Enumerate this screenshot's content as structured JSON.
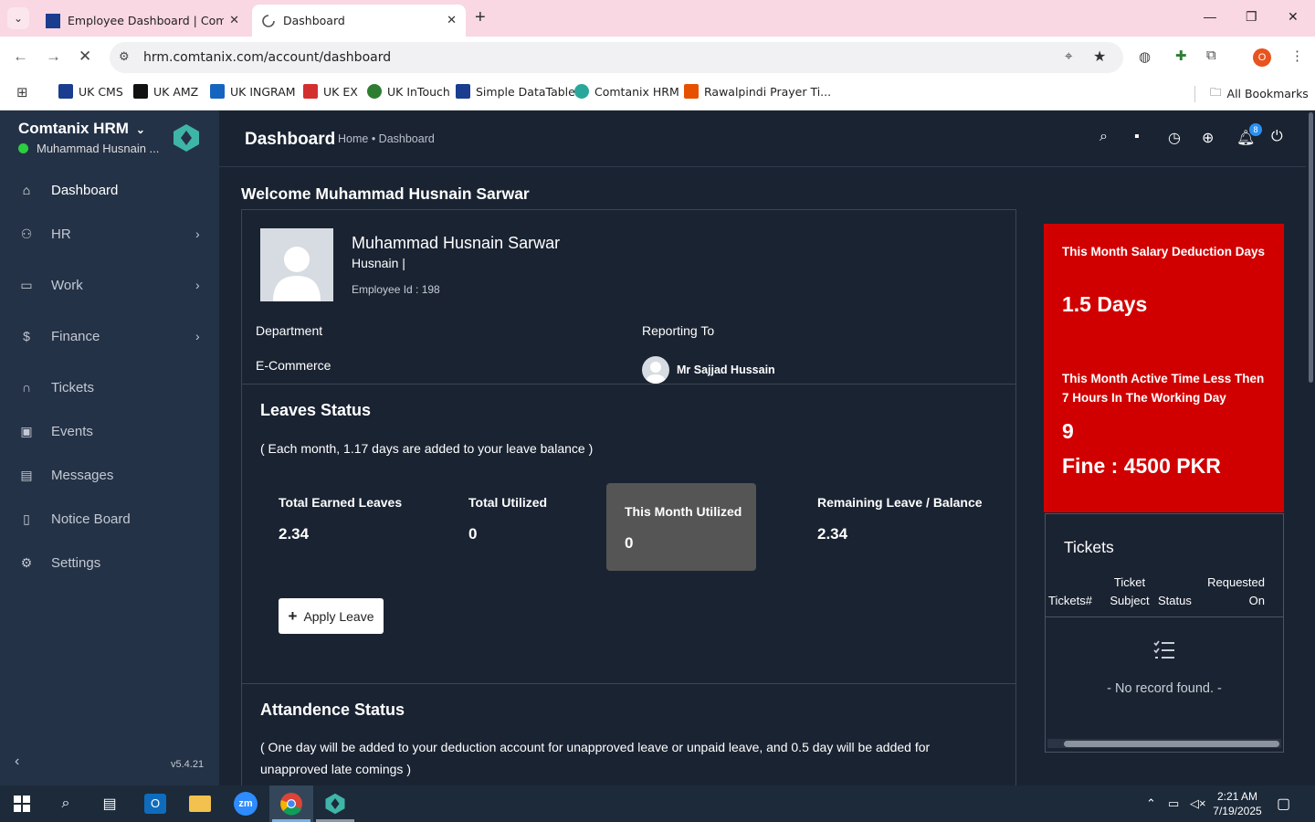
{
  "browser": {
    "tabs": [
      {
        "title": "Employee Dashboard | Comtanix",
        "active": false
      },
      {
        "title": "Dashboard",
        "active": true
      }
    ],
    "url": "hrm.comtanix.com/account/dashboard",
    "profile_initial": "O",
    "bookmarks": [
      {
        "label": "UK CMS",
        "color": "#1a3d8f"
      },
      {
        "label": "UK AMZ",
        "color": "#111111"
      },
      {
        "label": "UK INGRAM",
        "color": "#1565c0"
      },
      {
        "label": "UK EX",
        "color": "#d32f2f"
      },
      {
        "label": "UK InTouch",
        "color": "#2e7d32"
      },
      {
        "label": "Simple DataTable",
        "color": "#1a3d8f"
      },
      {
        "label": "Comtanix HRM",
        "color": "#2aa79b"
      },
      {
        "label": "Rawalpindi Prayer Ti...",
        "color": "#e65100"
      }
    ],
    "all_bookmarks": "All Bookmarks"
  },
  "sidebar": {
    "brand": "Comtanix HRM",
    "user": "Muhammad Husnain ...",
    "items": [
      {
        "label": "Dashboard",
        "icon": "home-icon",
        "active": true
      },
      {
        "label": "HR",
        "icon": "users-icon",
        "arrow": true
      },
      {
        "label": "Work",
        "icon": "briefcase-icon",
        "arrow": true
      },
      {
        "label": "Finance",
        "icon": "dollar-icon",
        "arrow": true
      },
      {
        "label": "Tickets",
        "icon": "headset-icon"
      },
      {
        "label": "Events",
        "icon": "calendar-icon"
      },
      {
        "label": "Messages",
        "icon": "message-icon"
      },
      {
        "label": "Notice Board",
        "icon": "clipboard-icon"
      },
      {
        "label": "Settings",
        "icon": "gear-icon"
      }
    ],
    "version": "v5.4.21"
  },
  "header": {
    "title": "Dashboard",
    "breadcrumb": "Home • Dashboard",
    "notification_count": "8"
  },
  "welcome": "Welcome Muhammad Husnain Sarwar",
  "profile": {
    "name": "Muhammad Husnain Sarwar",
    "nickname": "Husnain |",
    "employee_id": "Employee Id : 198",
    "department_label": "Department",
    "department": "E-Commerce",
    "reporting_label": "Reporting To",
    "reporting_to": "Mr Sajjad Hussain"
  },
  "leaves": {
    "title": "Leaves Status",
    "note": "( Each month, 1.17 days are added to your leave balance )",
    "stats": [
      {
        "label": "Total Earned Leaves",
        "value": "2.34"
      },
      {
        "label": "Total Utilized",
        "value": "0"
      },
      {
        "label": "This Month Utilized",
        "value": "0"
      },
      {
        "label": "Remaining Leave / Balance",
        "value": "2.34"
      }
    ],
    "apply_button": "Apply Leave"
  },
  "attendance": {
    "title": "Attandence Status",
    "note": "( One day will be added to your deduction account for unapproved leave or unpaid leave, and 0.5 day will be added for unapproved late comings )"
  },
  "deduction_card": {
    "salary_label": "This Month Salary Deduction Days",
    "salary_value": "1.5 Days",
    "active_label": "This Month Active Time Less Then 7 Hours In The Working Day",
    "active_value": "9",
    "fine": "Fine : 4500 PKR",
    "color": "#d10000"
  },
  "tickets": {
    "title": "Tickets",
    "headers": [
      "Tickets#",
      "Ticket Subject",
      "Status",
      "Requested On"
    ],
    "empty": "- No record found. -"
  },
  "taskbar": {
    "time": "2:21 AM",
    "date": "7/19/2025"
  }
}
